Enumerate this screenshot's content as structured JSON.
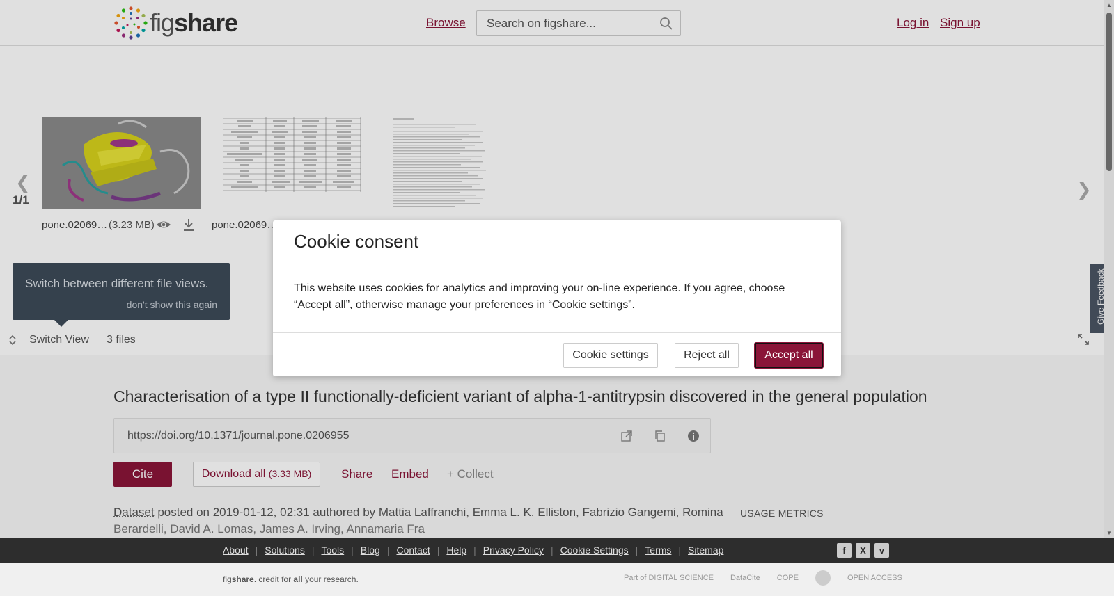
{
  "header": {
    "logo_text_light": "fig",
    "logo_text_bold": "share",
    "browse_label": "Browse",
    "search_placeholder": "Search on figshare...",
    "login_label": "Log in",
    "signup_label": "Sign up"
  },
  "viewer": {
    "page_count": "1/1",
    "files": [
      {
        "name": "pone.02069…",
        "size": "(3.23 MB)"
      },
      {
        "name": "pone.02069…"
      }
    ],
    "tooltip_text": "Switch between different file views.",
    "tooltip_dismiss": "don't show this again",
    "switch_view_label": "Switch View",
    "file_count": "3 files",
    "feedback_label": "Give Feedback"
  },
  "article": {
    "title": "Characterisation of a type II functionally-deficient variant of alpha-1-antitrypsin discovered in the general population",
    "doi": "https://doi.org/10.1371/journal.pone.0206955",
    "cite_label": "Cite",
    "download_label": "Download all",
    "download_size": "(3.33 MB)",
    "share_label": "Share",
    "embed_label": "Embed",
    "collect_label": "+ Collect",
    "item_type": "Dataset",
    "posted_text": " posted on 2019-01-12, 02:31 authored by Mattia Laffranchi, Emma L. K. Elliston, Fabrizio Gangemi, Romina",
    "posted_line2": "Berardelli, David A. Lomas, James A. Irving, Annamaria Fra",
    "usage_metrics_label": "USAGE METRICS"
  },
  "footer": {
    "links": [
      "About",
      "Solutions",
      "Tools",
      "Blog",
      "Contact",
      "Help",
      "Privacy Policy",
      "Cookie Settings",
      "Terms",
      "Sitemap"
    ],
    "tagline_pre": "fig",
    "tagline_bold": "share",
    "tagline_mid": ". credit for ",
    "tagline_all": "all",
    "tagline_post": " your research.",
    "partners": [
      "Part of DIGITAL SCIENCE",
      "DataCite",
      "COPE",
      "",
      "OPEN ACCESS"
    ]
  },
  "cookie_modal": {
    "title": "Cookie consent",
    "text": "This website uses cookies for analytics and improving your on-line experience. If you agree, choose “Accept all”, otherwise manage your preferences in “Cookie settings”.",
    "settings_label": "Cookie settings",
    "reject_label": "Reject all",
    "accept_label": "Accept all"
  },
  "colors": {
    "brand": "#8a1538",
    "footer_dark": "#2d2d2d",
    "tooltip_bg": "#3d4a58"
  },
  "icons": [
    "search-icon",
    "eye-icon",
    "download-icon",
    "chevron-left-icon",
    "chevron-right-icon",
    "switch-view-icon",
    "expand-icon",
    "external-link-icon",
    "copy-icon",
    "info-icon",
    "facebook-icon",
    "x-icon",
    "vimeo-icon"
  ]
}
